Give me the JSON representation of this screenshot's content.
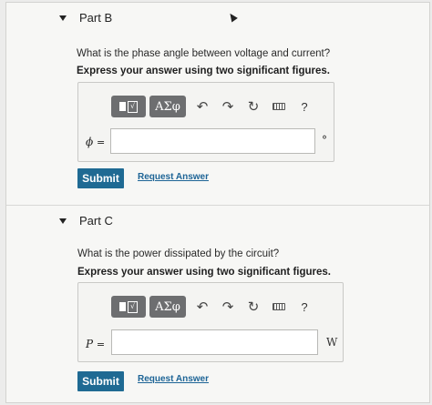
{
  "partB": {
    "title": "Part B",
    "question": "What is the phase angle between voltage and current?",
    "instruction": "Express your answer using two significant figures.",
    "toolbar": {
      "template_icon": "template-radical-icon",
      "template_glyph": "√",
      "greek_label": "ΑΣφ",
      "undo_icon": "undo-icon",
      "redo_icon": "redo-icon",
      "reset_icon": "reset-icon",
      "keyboard_icon": "keyboard-icon",
      "help_label": "?"
    },
    "variable": "ϕ",
    "equals": "=",
    "input_value": "",
    "unit": "°",
    "submit_label": "Submit",
    "request_label": "Request Answer"
  },
  "partC": {
    "title": "Part C",
    "question": "What is the power dissipated by the circuit?",
    "instruction": "Express your answer using two significant figures.",
    "toolbar": {
      "template_icon": "template-radical-icon",
      "template_glyph": "√",
      "greek_label": "ΑΣφ",
      "undo_icon": "undo-icon",
      "redo_icon": "redo-icon",
      "reset_icon": "reset-icon",
      "keyboard_icon": "keyboard-icon",
      "help_label": "?"
    },
    "variable": "P",
    "equals": "=",
    "input_value": "",
    "unit": "W",
    "submit_label": "Submit",
    "request_label": "Request Answer"
  },
  "colors": {
    "submit": "#1f6a93",
    "link": "#1d6496",
    "toolbar_button": "#6d6e70"
  }
}
